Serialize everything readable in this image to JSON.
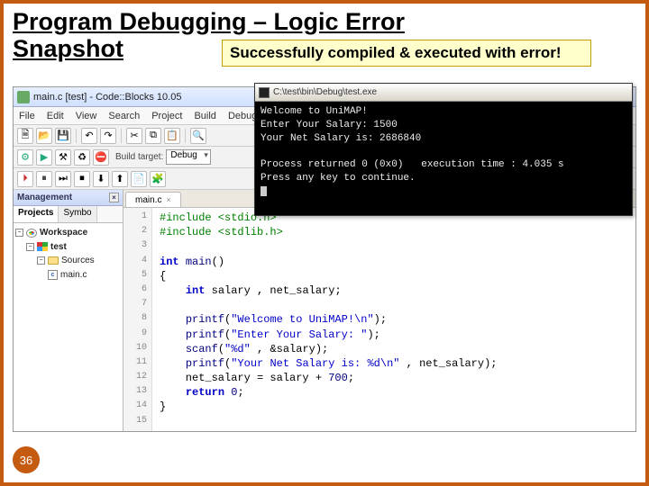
{
  "slide": {
    "title_line1": "Program Debugging – Logic Error",
    "title_line2": "Snapshot",
    "callout": "Successfully compiled & executed with error!",
    "page_number": "36"
  },
  "ide": {
    "window_title": "main.c [test] - Code::Blocks 10.05",
    "menu": [
      "File",
      "Edit",
      "View",
      "Search",
      "Project",
      "Build",
      "Debug"
    ],
    "build_target_label": "Build target:",
    "build_target_value": "Debug",
    "mgmt": {
      "title": "Management",
      "tabs": [
        "Projects",
        "Symbo"
      ],
      "tree": {
        "workspace": "Workspace",
        "project": "test",
        "folder": "Sources",
        "file": "main.c"
      }
    },
    "editor_tab": "main.c",
    "code_lines": [
      "#include <stdio.h>",
      "#include <stdlib.h>",
      "",
      "int main()",
      "{",
      "    int salary , net_salary;",
      "",
      "    printf(\"Welcome to UniMAP!\\n\");",
      "    printf(\"Enter Your Salary: \");",
      "    scanf(\"%d\" , &salary);",
      "    printf(\"Your Net Salary is: %d\\n\" , net_salary);",
      "    net_salary = salary + 700;",
      "    return 0;",
      "}",
      ""
    ]
  },
  "console": {
    "title": "C:\\test\\bin\\Debug\\test.exe",
    "lines": [
      "Welcome to UniMAP!",
      "Enter Your Salary: 1500",
      "Your Net Salary is: 2686840",
      "",
      "Process returned 0 (0x0)   execution time : 4.035 s",
      "Press any key to continue."
    ]
  },
  "icons": {
    "new": "🗎",
    "open": "📂",
    "save": "💾",
    "undo": "↶",
    "redo": "↷",
    "cut": "✂",
    "copy": "⧉",
    "paste": "📋",
    "find": "🔍",
    "run": "▶",
    "build": "⚙",
    "buildrun": "⚒",
    "stop": "⛔",
    "rebuild": "♻",
    "dbg1": "⏵",
    "dbg2": "⏸",
    "dbg3": "⏭",
    "dbg4": "⏹",
    "dbg5": "⬇",
    "dbg6": "⬆",
    "dbg7": "📄",
    "dbg8": "🧩"
  }
}
